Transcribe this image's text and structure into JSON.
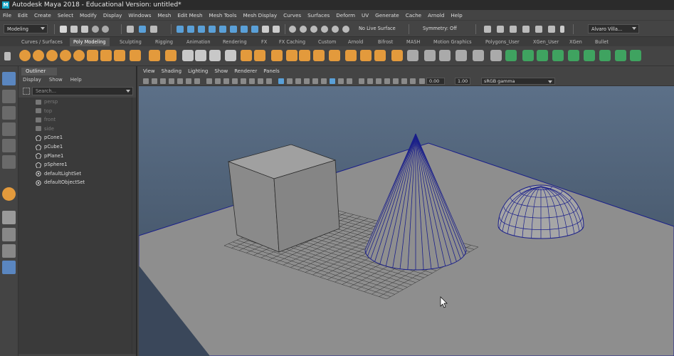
{
  "app": {
    "title": "Autodesk Maya 2018 - Educational Version: untitled*",
    "logo_letter": "M"
  },
  "menubar": {
    "items": [
      "File",
      "Edit",
      "Create",
      "Select",
      "Modify",
      "Display",
      "Windows",
      "Mesh",
      "Edit Mesh",
      "Mesh Tools",
      "Mesh Display",
      "Curves",
      "Surfaces",
      "Deform",
      "UV",
      "Generate",
      "Cache",
      "Arnold",
      "Help"
    ]
  },
  "statusline": {
    "menuset": "Modeling",
    "live_surface": "No Live Surface",
    "symmetry": "Symmetry: Off",
    "user": "Alvaro Villa..."
  },
  "shelf": {
    "tabs": [
      "Curves / Surfaces",
      "Poly Modeling",
      "Sculpting",
      "Rigging",
      "Animation",
      "Rendering",
      "FX",
      "FX Caching",
      "Custom",
      "Arnold",
      "Bifrost",
      "MASH",
      "Motion Graphics",
      "Polygons_User",
      "XGen_User",
      "XGen",
      "Bullet"
    ],
    "active_tab": "Poly Modeling"
  },
  "outliner": {
    "tab_label": "Outliner",
    "menu": [
      "Display",
      "Show",
      "Help"
    ],
    "search_placeholder": "Search...",
    "items": [
      {
        "label": "persp",
        "kind": "camera"
      },
      {
        "label": "top",
        "kind": "camera"
      },
      {
        "label": "front",
        "kind": "camera"
      },
      {
        "label": "side",
        "kind": "camera"
      },
      {
        "label": "pCone1",
        "kind": "mesh"
      },
      {
        "label": "pCube1",
        "kind": "mesh"
      },
      {
        "label": "pPlane1",
        "kind": "mesh"
      },
      {
        "label": "pSphere1",
        "kind": "mesh"
      },
      {
        "label": "defaultLightSet",
        "kind": "set"
      },
      {
        "label": "defaultObjectSet",
        "kind": "set"
      }
    ]
  },
  "viewport": {
    "menu": [
      "View",
      "Shading",
      "Lighting",
      "Show",
      "Renderer",
      "Panels"
    ],
    "exposure": "0.00",
    "gamma": "1.00",
    "color_space": "sRGB gamma",
    "colors": {
      "background_top": "#5c7088",
      "background_bottom": "#3b4a5c",
      "object_grey": "#8f8f8f",
      "wireframe": "#1a1f8a"
    }
  },
  "colors": {
    "shelf_orange": "#e39a3c",
    "shelf_green": "#3fa360",
    "select_blue": "#5aa0d8"
  }
}
